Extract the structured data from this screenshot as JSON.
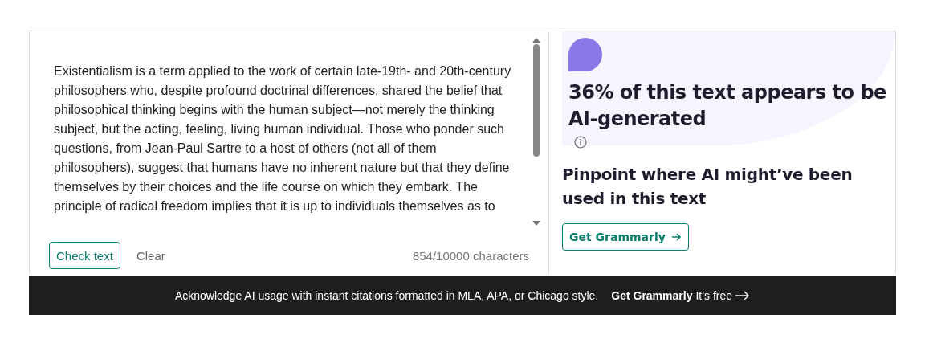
{
  "editor": {
    "text": "Existentialism is a term applied to the work of certain late-19th- and 20th-century philosophers who, despite profound doctrinal differences, shared the belief that philosophical thinking begins with the human subject—not merely the thinking subject, but the acting, feeling, living human individual. Those who ponder such questions, from Jean-Paul Sartre to a host of others (not all of them philosophers), suggest that humans have no inherent nature but that they define themselves by their choices and the life course on which they embark. The principle of radical freedom implies that it is up to individuals themselves as to",
    "check_button": "Check text",
    "clear_button": "Clear",
    "counter": "854/10000 characters"
  },
  "result": {
    "heading": "36% of this text appears to be AI-generated",
    "subheading": "Pinpoint where AI might’ve been used in this text",
    "button": "Get Grammarly"
  },
  "banner": {
    "text": "Acknowledge AI usage with instant citations formatted in MLA, APA, or Chicago style.",
    "link_bold": "Get Grammarly",
    "link_rest": "It’s free"
  }
}
